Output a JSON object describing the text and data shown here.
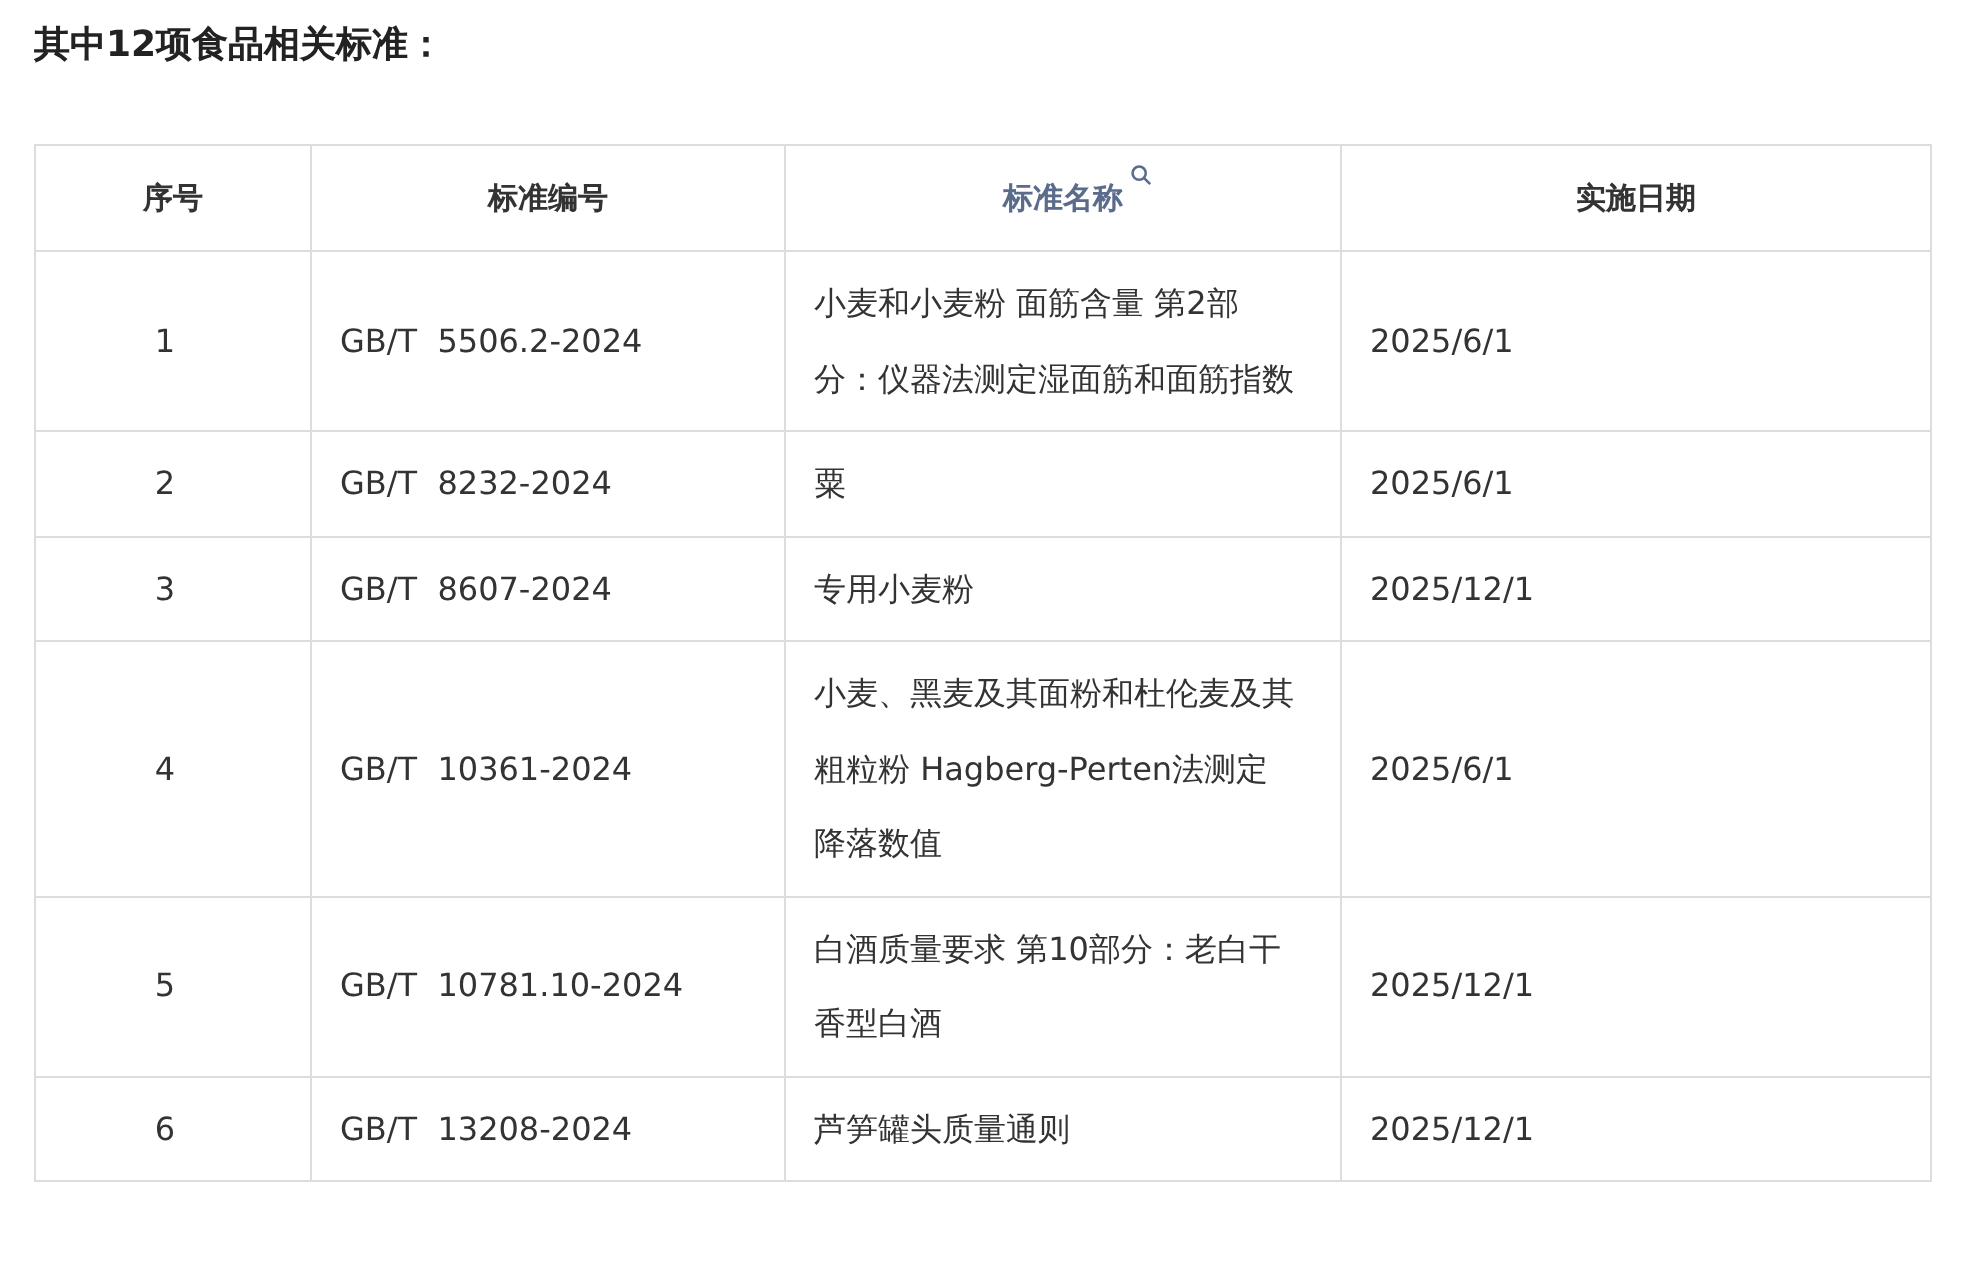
{
  "heading": "其中12项食品相关标准：",
  "table": {
    "columns": [
      {
        "label": "序号",
        "searchable": false
      },
      {
        "label": "标准编号",
        "searchable": false
      },
      {
        "label": "标准名称",
        "searchable": true
      },
      {
        "label": "实施日期",
        "searchable": false
      }
    ],
    "rows": [
      {
        "index": "1",
        "code": "GB/T  5506.2-2024",
        "name": "小麦和小麦粉 面筋含量 第2部分：仪器法测定湿面筋和面筋指数",
        "date": "2025/6/1"
      },
      {
        "index": "2",
        "code": "GB/T  8232-2024",
        "name": "粟",
        "date": "2025/6/1"
      },
      {
        "index": "3",
        "code": "GB/T  8607-2024",
        "name": "专用小麦粉",
        "date": "2025/12/1"
      },
      {
        "index": "4",
        "code": "GB/T  10361-2024",
        "name": "小麦、黑麦及其面粉和杜伦麦及其粗粒粉 Hagberg-Perten法测定降落数值",
        "date": "2025/6/1"
      },
      {
        "index": "5",
        "code": "GB/T  10781.10-2024",
        "name": "白酒质量要求 第10部分：老白干香型白酒",
        "date": "2025/12/1"
      },
      {
        "index": "6",
        "code": "GB/T  13208-2024",
        "name": "芦笋罐头质量通则",
        "date": "2025/12/1"
      }
    ]
  }
}
